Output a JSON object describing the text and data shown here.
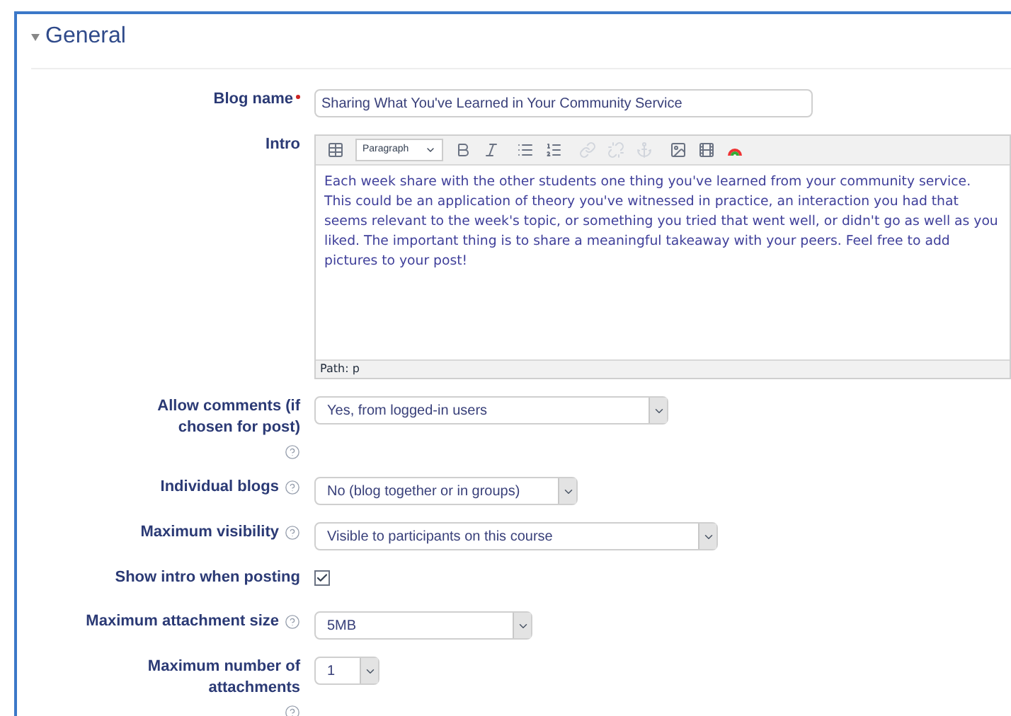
{
  "section": {
    "title": "General",
    "expanded": true
  },
  "fields": [
    {
      "kind": "text",
      "label": "Blog name",
      "required": true,
      "help": false,
      "value": "Sharing What You've Learned in Your Community Service"
    },
    {
      "kind": "editor",
      "label": "Intro",
      "required": false,
      "help": false,
      "format": "Paragraph",
      "value": "Each week share with the other students one thing you've learned from your community service. This could be an application of theory you've witnessed in practice, an interaction you had that seems relevant to the week's topic, or something you tried that went well, or didn't go as well as you liked.  The important thing is to share a meaningful takeaway with your peers.  Feel free to add pictures to your post!",
      "path": "Path: p"
    },
    {
      "kind": "select",
      "label": "Allow comments (if chosen for post)",
      "required": false,
      "help": true,
      "value": "Yes, from logged-in users"
    },
    {
      "kind": "select",
      "label": "Individual blogs",
      "required": false,
      "help": true,
      "value": "No (blog together or in groups)"
    },
    {
      "kind": "select",
      "label": "Maximum visibility",
      "required": false,
      "help": true,
      "value": "Visible to participants on this course"
    },
    {
      "kind": "checkbox",
      "label": "Show intro when posting",
      "required": false,
      "help": false,
      "checked": true
    },
    {
      "kind": "select",
      "label": "Maximum attachment size",
      "required": false,
      "help": true,
      "value": "5MB"
    },
    {
      "kind": "select",
      "label": "Maximum number of attachments",
      "required": false,
      "help": true,
      "value": "1"
    }
  ]
}
